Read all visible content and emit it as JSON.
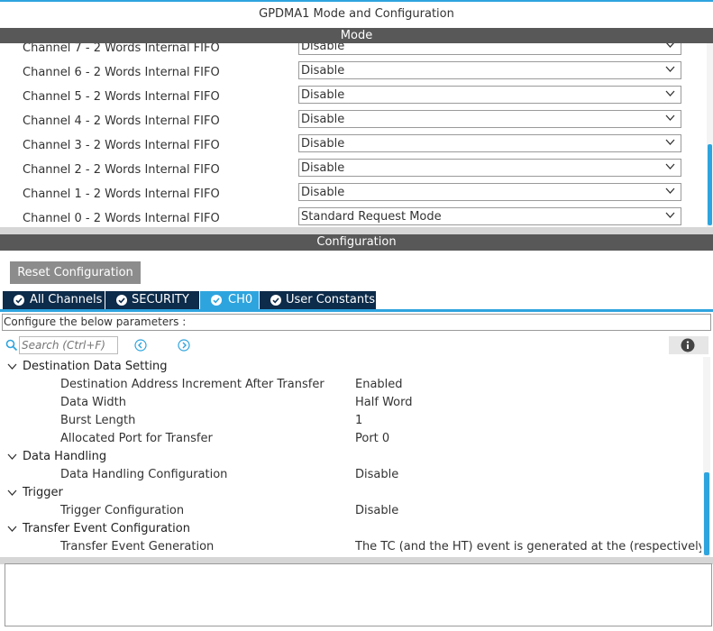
{
  "window": {
    "title": "GPDMA1 Mode and Configuration"
  },
  "mode": {
    "header": "Mode",
    "channels": [
      {
        "label": "Channel 7  - 2 Words Internal FIFO",
        "value": "Disable"
      },
      {
        "label": "Channel 6  - 2 Words Internal FIFO",
        "value": "Disable"
      },
      {
        "label": "Channel 5  - 2 Words Internal FIFO",
        "value": "Disable"
      },
      {
        "label": "Channel 4  - 2 Words Internal FIFO",
        "value": "Disable"
      },
      {
        "label": "Channel 3  - 2 Words Internal FIFO",
        "value": "Disable"
      },
      {
        "label": "Channel 2  - 2 Words Internal FIFO",
        "value": "Disable"
      },
      {
        "label": "Channel 1  - 2 Words Internal FIFO",
        "value": "Disable"
      },
      {
        "label": "Channel 0  - 2 Words Internal FIFO",
        "value": "Standard Request Mode"
      }
    ]
  },
  "configuration": {
    "header": "Configuration",
    "reset_label": "Reset Configuration",
    "tabs": [
      {
        "label": "All Channels",
        "active": false
      },
      {
        "label": "SECURITY",
        "active": false
      },
      {
        "label": "CH0",
        "active": true
      },
      {
        "label": "User Constants",
        "active": false
      }
    ],
    "instruction": "Configure the below parameters :",
    "search_placeholder": "Search (Ctrl+F)",
    "tree": [
      {
        "category": "Destination Data Setting",
        "params": [
          {
            "name": "Destination Address Increment After Transfer",
            "value": "Enabled"
          },
          {
            "name": "Data Width",
            "value": "Half Word"
          },
          {
            "name": "Burst Length",
            "value": "1"
          },
          {
            "name": "Allocated Port for Transfer",
            "value": "Port 0"
          }
        ]
      },
      {
        "category": "Data Handling",
        "params": [
          {
            "name": "Data Handling Configuration",
            "value": "Disable"
          }
        ]
      },
      {
        "category": "Trigger",
        "params": [
          {
            "name": "Trigger Configuration",
            "value": "Disable"
          }
        ]
      },
      {
        "category": "Transfer Event Configuration",
        "params": [
          {
            "name": "Transfer Event Generation",
            "value": "The TC (and the HT) event is generated at the (respectively half) ..."
          }
        ]
      }
    ]
  },
  "icons": {
    "tab_check": "check-circle-icon",
    "search": "search-icon",
    "prev": "arrow-left-circle-icon",
    "next": "arrow-right-circle-icon",
    "info": "info-icon",
    "expand": "chevron-down-icon"
  },
  "colors": {
    "accent": "#2ea4de",
    "tab_dark": "#0d2b4a",
    "header_bar": "#585858"
  }
}
